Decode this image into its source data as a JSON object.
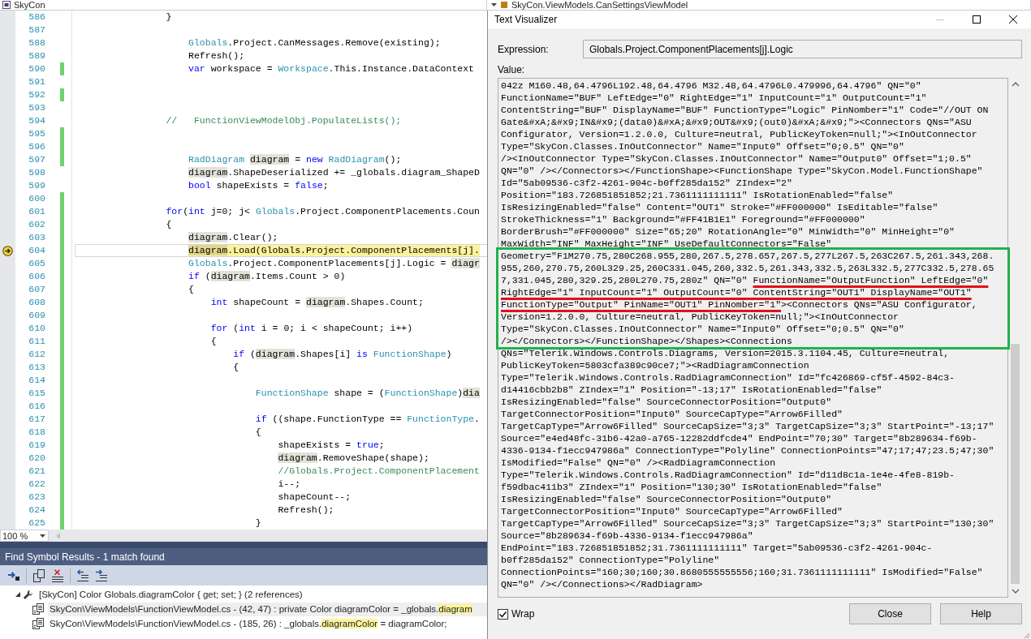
{
  "nav_bar": {
    "project": "SkyCon",
    "type": "SkyCon.ViewModels.CanSettingsViewModel"
  },
  "editor": {
    "lines": [
      {
        "number": "586",
        "changed": false,
        "current": false,
        "tokens": [
          {
            "kind": "plain",
            "text": "                }"
          }
        ]
      },
      {
        "number": "587",
        "changed": false,
        "current": false
      },
      {
        "number": "588",
        "changed": false,
        "current": false,
        "tokens": [
          {
            "kind": "type",
            "text": "                    Globals"
          },
          {
            "kind": "plain",
            "text": ".Project.CanMessages.Remove(existing);"
          }
        ]
      },
      {
        "number": "589",
        "changed": false,
        "current": false,
        "tokens": [
          {
            "kind": "plain",
            "text": "                    Refresh();"
          }
        ]
      },
      {
        "number": "590",
        "changed": true,
        "current": false,
        "tokens": [
          {
            "kind": "keyword",
            "text": "                    var"
          },
          {
            "kind": "plain",
            "text": " workspace = "
          },
          {
            "kind": "type",
            "text": "Workspace"
          },
          {
            "kind": "plain",
            "text": ".This.Instance.DataContext"
          }
        ]
      },
      {
        "number": "591",
        "changed": false,
        "current": false
      },
      {
        "number": "592",
        "changed": true,
        "current": false
      },
      {
        "number": "593",
        "changed": false,
        "current": false
      },
      {
        "number": "594",
        "changed": false,
        "current": false,
        "tokens": [
          {
            "kind": "comment",
            "text": "                //   FunctionViewModelObj.PopulateLists();"
          }
        ]
      },
      {
        "number": "595",
        "changed": true,
        "current": false
      },
      {
        "number": "596",
        "changed": true,
        "current": false
      },
      {
        "number": "597",
        "changed": true,
        "current": false,
        "tokens": [
          {
            "kind": "type",
            "text": "                    RadDiagram "
          },
          {
            "kind": "reference",
            "text": "diagram"
          },
          {
            "kind": "plain",
            "text": " = "
          },
          {
            "kind": "keyword",
            "text": "new "
          },
          {
            "kind": "type",
            "text": "RadDiagram"
          },
          {
            "kind": "plain",
            "text": "();"
          }
        ]
      },
      {
        "number": "598",
        "changed": false,
        "current": false,
        "tokens": [
          {
            "kind": "reference",
            "text": "                    diagram"
          },
          {
            "kind": "plain",
            "text": ".ShapeDeserialized += _globals.diagram_ShapeD"
          }
        ]
      },
      {
        "number": "599",
        "changed": false,
        "current": false,
        "tokens": [
          {
            "kind": "keyword",
            "text": "                    bool"
          },
          {
            "kind": "plain",
            "text": " shapeExists = "
          },
          {
            "kind": "keyword",
            "text": "false"
          },
          {
            "kind": "plain",
            "text": ";"
          }
        ]
      },
      {
        "number": "600",
        "changed": true,
        "current": false
      },
      {
        "number": "601",
        "changed": true,
        "current": false,
        "tokens": [
          {
            "kind": "keyword",
            "text": "                for"
          },
          {
            "kind": "plain",
            "text": "("
          },
          {
            "kind": "keyword",
            "text": "int"
          },
          {
            "kind": "plain",
            "text": " j=0; j< "
          },
          {
            "kind": "type",
            "text": "Globals"
          },
          {
            "kind": "plain",
            "text": ".Project.ComponentPlacements.Coun"
          }
        ]
      },
      {
        "number": "602",
        "changed": true,
        "current": false,
        "tokens": [
          {
            "kind": "plain",
            "text": "                {"
          }
        ]
      },
      {
        "number": "603",
        "changed": true,
        "current": false,
        "tokens": [
          {
            "kind": "reference",
            "text": "                    diagram"
          },
          {
            "kind": "plain",
            "text": ".Clear();"
          }
        ]
      },
      {
        "number": "604",
        "changed": true,
        "current": true,
        "tokens": [
          {
            "kind": "reference",
            "text": "                    diagram"
          },
          {
            "kind": "plain",
            "text": ".Load(Globals.Project.ComponentPlacements[j]."
          }
        ]
      },
      {
        "number": "605",
        "changed": true,
        "current": false,
        "tokens": [
          {
            "kind": "type",
            "text": "                    Globals"
          },
          {
            "kind": "plain",
            "text": ".Project.ComponentPlacements[j].Logic = "
          },
          {
            "kind": "reference",
            "text": "diagr"
          }
        ]
      },
      {
        "number": "606",
        "changed": true,
        "current": false,
        "tokens": [
          {
            "kind": "keyword",
            "text": "                    if"
          },
          {
            "kind": "plain",
            "text": " ("
          },
          {
            "kind": "reference",
            "text": "diagram"
          },
          {
            "kind": "plain",
            "text": ".Items.Count > 0)"
          }
        ]
      },
      {
        "number": "607",
        "changed": true,
        "current": false,
        "tokens": [
          {
            "kind": "plain",
            "text": "                    {"
          }
        ]
      },
      {
        "number": "608",
        "changed": true,
        "current": false,
        "tokens": [
          {
            "kind": "keyword",
            "text": "                        int"
          },
          {
            "kind": "plain",
            "text": " shapeCount = "
          },
          {
            "kind": "reference",
            "text": "diagram"
          },
          {
            "kind": "plain",
            "text": ".Shapes.Count;"
          }
        ]
      },
      {
        "number": "609",
        "changed": true,
        "current": false
      },
      {
        "number": "610",
        "changed": true,
        "current": false,
        "tokens": [
          {
            "kind": "keyword",
            "text": "                        for"
          },
          {
            "kind": "plain",
            "text": " ("
          },
          {
            "kind": "keyword",
            "text": "int"
          },
          {
            "kind": "plain",
            "text": " i = 0; i < shapeCount; i++)"
          }
        ]
      },
      {
        "number": "611",
        "changed": true,
        "current": false,
        "tokens": [
          {
            "kind": "plain",
            "text": "                        {"
          }
        ]
      },
      {
        "number": "612",
        "changed": true,
        "current": false,
        "tokens": [
          {
            "kind": "keyword",
            "text": "                            if"
          },
          {
            "kind": "plain",
            "text": " ("
          },
          {
            "kind": "reference",
            "text": "diagram"
          },
          {
            "kind": "plain",
            "text": ".Shapes[i] "
          },
          {
            "kind": "keyword",
            "text": "is "
          },
          {
            "kind": "type",
            "text": "FunctionShape"
          },
          {
            "kind": "plain",
            "text": ")"
          }
        ]
      },
      {
        "number": "613",
        "changed": true,
        "current": false,
        "tokens": [
          {
            "kind": "plain",
            "text": "                            {"
          }
        ]
      },
      {
        "number": "614",
        "changed": true,
        "current": false
      },
      {
        "number": "615",
        "changed": true,
        "current": false,
        "tokens": [
          {
            "kind": "type",
            "text": "                                FunctionShape"
          },
          {
            "kind": "plain",
            "text": " shape = ("
          },
          {
            "kind": "type",
            "text": "FunctionShape"
          },
          {
            "kind": "plain",
            "text": ")"
          },
          {
            "kind": "reference",
            "text": "dia"
          }
        ]
      },
      {
        "number": "616",
        "changed": true,
        "current": false
      },
      {
        "number": "617",
        "changed": true,
        "current": false,
        "tokens": [
          {
            "kind": "keyword",
            "text": "                                if"
          },
          {
            "kind": "plain",
            "text": " ((shape.FunctionType == "
          },
          {
            "kind": "type",
            "text": "FunctionType"
          },
          {
            "kind": "plain",
            "text": "."
          }
        ]
      },
      {
        "number": "618",
        "changed": true,
        "current": false,
        "tokens": [
          {
            "kind": "plain",
            "text": "                                {"
          }
        ]
      },
      {
        "number": "619",
        "changed": true,
        "current": false,
        "tokens": [
          {
            "kind": "plain",
            "text": "                                    shapeExists = "
          },
          {
            "kind": "keyword",
            "text": "true"
          },
          {
            "kind": "plain",
            "text": ";"
          }
        ]
      },
      {
        "number": "620",
        "changed": true,
        "current": false,
        "tokens": [
          {
            "kind": "reference",
            "text": "                                    diagram"
          },
          {
            "kind": "plain",
            "text": ".RemoveShape(shape);"
          }
        ]
      },
      {
        "number": "621",
        "changed": true,
        "current": false,
        "tokens": [
          {
            "kind": "comment",
            "text": "                                    //Globals.Project.ComponentPlacement"
          }
        ]
      },
      {
        "number": "622",
        "changed": true,
        "current": false,
        "tokens": [
          {
            "kind": "plain",
            "text": "                                    i--;"
          }
        ]
      },
      {
        "number": "623",
        "changed": true,
        "current": false,
        "tokens": [
          {
            "kind": "plain",
            "text": "                                    shapeCount--;"
          }
        ]
      },
      {
        "number": "624",
        "changed": true,
        "current": false,
        "tokens": [
          {
            "kind": "plain",
            "text": "                                    Refresh();"
          }
        ]
      },
      {
        "number": "625",
        "changed": true,
        "current": false,
        "tokens": [
          {
            "kind": "plain",
            "text": "                                }"
          }
        ]
      }
    ]
  },
  "zoom_level": "100 %",
  "find_results": {
    "title": "Find Symbol Results - 1 match found",
    "items": [
      {
        "text": "[SkyCon] Color Globals.diagramColor { get; set; } (2 references)",
        "expanded": true,
        "selected": false,
        "children": [
          {
            "selected": true,
            "segments": [
              {
                "text": "SkyCon\\ViewModels\\FunctionViewModel.cs - (42, 47) : private Color diagramColor = _globals.",
                "highlighted": false
              },
              {
                "text": "diagram",
                "highlighted": true
              }
            ]
          },
          {
            "selected": false,
            "segments": [
              {
                "text": "SkyCon\\ViewModels\\FunctionViewModel.cs - (185, 26) : _globals.",
                "highlighted": false
              },
              {
                "text": "diagramColor",
                "highlighted": true
              },
              {
                "text": " = diagramColor;",
                "highlighted": false
              }
            ]
          }
        ]
      }
    ]
  },
  "dialog": {
    "title": "Text Visualizer",
    "controls": [
      {
        "kind": "minimize",
        "disabled": true
      },
      {
        "kind": "maximize",
        "disabled": false
      },
      {
        "kind": "close",
        "disabled": false
      }
    ],
    "expression_label": "Expression:",
    "expression": "Globals.Project.ComponentPlacements[j].Logic",
    "value_label": "Value:",
    "value": {
      "blocks": [
        {
          "boxed": false,
          "lines": [
            [
              {
                "text": "042z M160.48,64.4796L192.48,64.4796 M32.48,64.4796L0.479996,64.4796\" QN=\"0\"",
                "underlined": false
              }
            ],
            [
              {
                "text": "FunctionName=\"BUF\" LeftEdge=\"0\" RightEdge=\"1\" InputCount=\"1\" OutputCount=\"1\"",
                "underlined": false
              }
            ],
            [
              {
                "text": "ContentString=\"BUF\" DisplayName=\"BUF\" FunctionType=\"Logic\" PinNomber=\"1\" Code=\"//OUT ON",
                "underlined": false
              }
            ],
            [
              {
                "text": "Gate&#xA;&#x9;IN&#x9;(data0)&#xA;&#x9;OUT&#x9;(out0)&#xA;&#x9;\"><Connectors QNs=\"ASU",
                "underlined": false
              }
            ],
            [
              {
                "text": "Configurator, Version=1.2.0.0, Culture=neutral, PublicKeyToken=null;\"><InOutConnector",
                "underlined": false
              }
            ],
            [
              {
                "text": "Type=\"SkyCon.Classes.InOutConnector\" Name=\"Input0\" Offset=\"0;0.5\" QN=\"0\"",
                "underlined": false
              }
            ],
            [
              {
                "text": "/><InOutConnector Type=\"SkyCon.Classes.InOutConnector\" Name=\"Output0\" Offset=\"1;0.5\"",
                "underlined": false
              }
            ],
            [
              {
                "text": "QN=\"0\" /></Connectors></FunctionShape><FunctionShape Type=\"SkyCon.Model.FunctionShape\"",
                "underlined": false
              }
            ],
            [
              {
                "text": "Id=\"5ab09536-c3f2-4261-904c-b0ff285da152\" ZIndex=\"2\"",
                "underlined": false
              }
            ],
            [
              {
                "text": "Position=\"183.726851851852;21.7361111111111\" IsRotationEnabled=\"false\"",
                "underlined": false
              }
            ],
            [
              {
                "text": "IsResizingEnabled=\"false\" Content=\"OUT1\" Stroke=\"#FF000000\" IsEditable=\"false\"",
                "underlined": false
              }
            ],
            [
              {
                "text": "StrokeThickness=\"1\" Background=\"#FF41B1E1\" Foreground=\"#FF000000\"",
                "underlined": false
              }
            ],
            [
              {
                "text": "BorderBrush=\"#FF000000\" Size=\"65;20\" RotationAngle=\"0\" MinWidth=\"0\" MinHeight=\"0\"",
                "underlined": false
              }
            ],
            [
              {
                "text": "MaxWidth=\"INF\" MaxHeight=\"INF\" UseDefaultConnectors=\"False\"",
                "underlined": false
              }
            ]
          ]
        },
        {
          "boxed": true,
          "lines": [
            [
              {
                "text": "Geometry=\"F1M270.75,280C268.955,280,267.5,278.657,267.5,277L267.5,263C267.5,261.343,268.",
                "underlined": false
              }
            ],
            [
              {
                "text": "955,260,270.75,260L329.25,260C331.045,260,332.5,261.343,332.5,263L332.5,277C332.5,278.65",
                "underlined": false
              }
            ],
            [
              {
                "text": "7,331.045,280,329.25,280L270.75,280z\" QN=\"0\" ",
                "underlined": false
              },
              {
                "text": "FunctionName=\"OutputFunction\" LeftEdge=\"0\"",
                "underlined": true
              }
            ],
            [
              {
                "text": "RightEdge=\"1\" InputCount=\"1\" OutputCount=\"0\" ContentString=\"OUT1\" DisplayName=\"OUT1\"",
                "underlined": true
              }
            ],
            [
              {
                "text": "FunctionType=\"Output\" PinName=\"OUT1\" PinNomber=\"1\"",
                "underlined": true
              },
              {
                "text": "><Connectors QNs=\"ASU Configurator,",
                "underlined": false
              }
            ],
            [
              {
                "text": "Version=1.2.0.0, Culture=neutral, PublicKeyToken=null;\"><InOutConnector",
                "underlined": false
              }
            ],
            [
              {
                "text": "Type=\"SkyCon.Classes.InOutConnector\" Name=\"Input0\" Offset=\"0;0.5\" QN=\"0\"",
                "underlined": false
              }
            ],
            [
              {
                "text": "/></Connectors></FunctionShape></Shapes><Connections",
                "underlined": false
              }
            ]
          ]
        },
        {
          "boxed": false,
          "lines": [
            [
              {
                "text": "QNs=\"Telerik.Windows.Controls.Diagrams, Version=2015.3.1104.45, Culture=neutral,",
                "underlined": false
              }
            ],
            [
              {
                "text": "PublicKeyToken=5803cfa389c90ce7;\"><RadDiagramConnection",
                "underlined": false
              }
            ],
            [
              {
                "text": "Type=\"Telerik.Windows.Controls.RadDiagramConnection\" Id=\"fc426869-cf5f-4592-84c3-",
                "underlined": false
              }
            ],
            [
              {
                "text": "d14416cbb2b8\" ZIndex=\"1\" Position=\"-13;17\" IsRotationEnabled=\"false\"",
                "underlined": false
              }
            ],
            [
              {
                "text": "IsResizingEnabled=\"false\" SourceConnectorPosition=\"Output0\"",
                "underlined": false
              }
            ],
            [
              {
                "text": "TargetConnectorPosition=\"Input0\" SourceCapType=\"Arrow6Filled\"",
                "underlined": false
              }
            ],
            [
              {
                "text": "TargetCapType=\"Arrow6Filled\" SourceCapSize=\"3;3\" TargetCapSize=\"3;3\" StartPoint=\"-13;17\"",
                "underlined": false
              }
            ],
            [
              {
                "text": "Source=\"e4ed48fc-31b6-42a0-a765-12282ddfcde4\" EndPoint=\"70;30\" Target=\"8b289634-f69b-",
                "underlined": false
              }
            ],
            [
              {
                "text": "4336-9134-f1ecc947986a\" ConnectionType=\"Polyline\" ConnectionPoints=\"47;17;47;23.5;47;30\"",
                "underlined": false
              }
            ],
            [
              {
                "text": "IsModified=\"False\" QN=\"0\" /><RadDiagramConnection",
                "underlined": false
              }
            ],
            [
              {
                "text": "Type=\"Telerik.Windows.Controls.RadDiagramConnection\" Id=\"d11d8c1a-1e4e-4fe8-819b-",
                "underlined": false
              }
            ],
            [
              {
                "text": "f59dbac411b3\" ZIndex=\"1\" Position=\"130;30\" IsRotationEnabled=\"false\"",
                "underlined": false
              }
            ],
            [
              {
                "text": "IsResizingEnabled=\"false\" SourceConnectorPosition=\"Output0\"",
                "underlined": false
              }
            ],
            [
              {
                "text": "TargetConnectorPosition=\"Input0\" SourceCapType=\"Arrow6Filled\"",
                "underlined": false
              }
            ],
            [
              {
                "text": "TargetCapType=\"Arrow6Filled\" SourceCapSize=\"3;3\" TargetCapSize=\"3;3\" StartPoint=\"130;30\"",
                "underlined": false
              }
            ],
            [
              {
                "text": "Source=\"8b289634-f69b-4336-9134-f1ecc947986a\"",
                "underlined": false
              }
            ],
            [
              {
                "text": "EndPoint=\"183.726851851852;31.7361111111111\" Target=\"5ab09536-c3f2-4261-904c-",
                "underlined": false
              }
            ],
            [
              {
                "text": "b0ff285da152\" ConnectionType=\"Polyline\"",
                "underlined": false
              }
            ],
            [
              {
                "text": "ConnectionPoints=\"160;30;160;30.8680555555556;160;31.7361111111111\" IsModified=\"False\"",
                "underlined": false
              }
            ],
            [
              {
                "text": "QN=\"0\" /></Connections></RadDiagram>",
                "underlined": false
              }
            ]
          ]
        }
      ]
    },
    "wrap": {
      "label": "Wrap",
      "checked": true
    },
    "buttons": [
      "Close",
      "Help"
    ]
  }
}
